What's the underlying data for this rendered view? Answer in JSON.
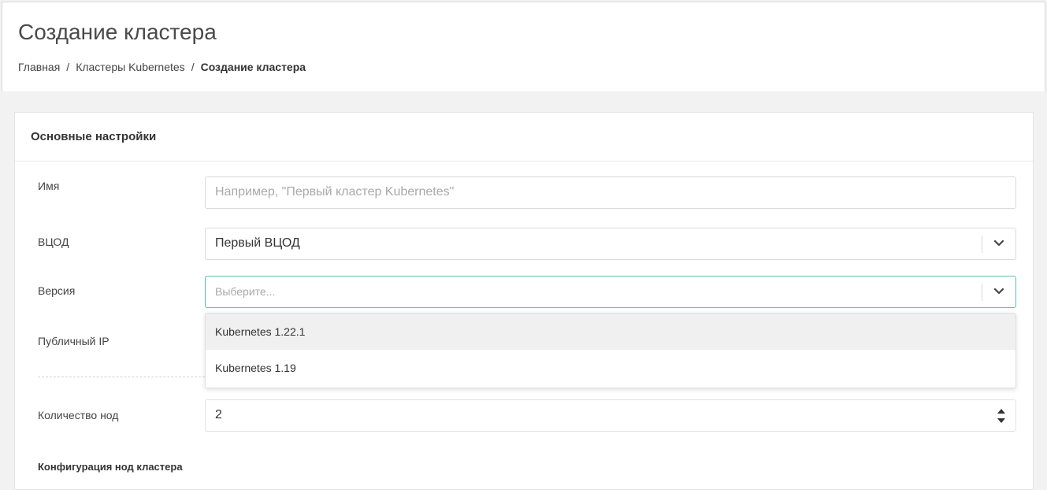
{
  "header": {
    "title": "Создание кластера",
    "breadcrumb": {
      "home": "Главная",
      "clusters": "Кластеры Kubernetes",
      "current": "Создание кластера",
      "separator": "/"
    }
  },
  "panel": {
    "heading": "Основные настройки",
    "name": {
      "label": "Имя",
      "placeholder": "Например, \"Первый кластер Kubernetes\"",
      "value": ""
    },
    "vdc": {
      "label": "ВЦОД",
      "value": "Первый ВЦОД"
    },
    "version": {
      "label": "Версия",
      "placeholder": "Выберите...",
      "options": [
        "Kubernetes 1.22.1",
        "Kubernetes 1.19"
      ]
    },
    "public_ip": {
      "label": "Публичный IP"
    },
    "node_count": {
      "label": "Количество нод",
      "value": "2"
    },
    "node_config_heading": "Конфигурация нод кластера"
  },
  "colors": {
    "focus_border": "#5bbfae",
    "option_hover": "#f0f0f0"
  }
}
